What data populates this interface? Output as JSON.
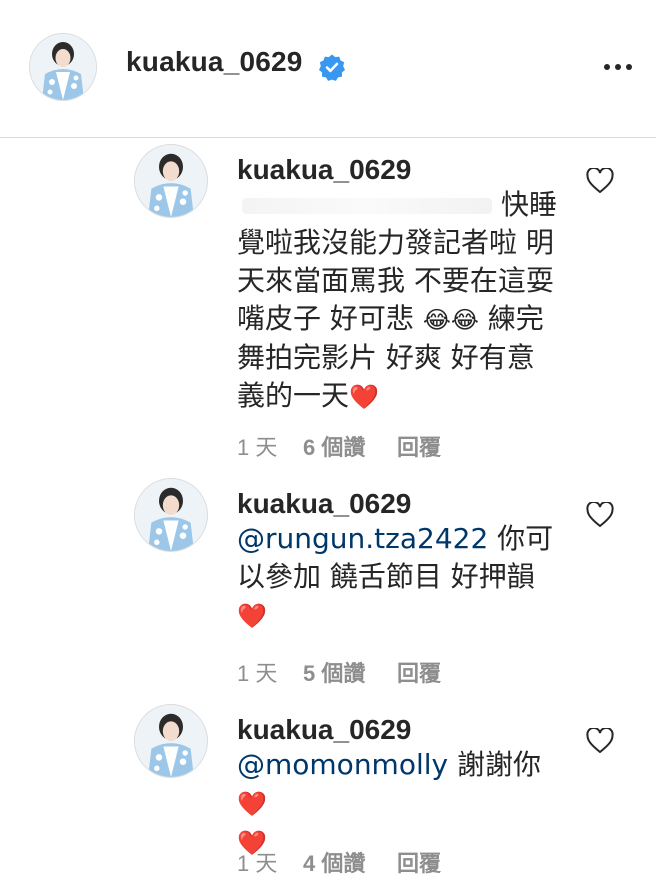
{
  "header": {
    "username": "kuakua_0629",
    "verified_icon": "verified-badge-icon",
    "more_icon": "more-options-icon"
  },
  "comments": [
    {
      "username": "kuakua_0629",
      "line1": "快睡",
      "lines": [
        "覺啦我沒能力發記者啦 明",
        "天來當面罵我 不要在這耍"
      ],
      "line4_text": "嘴皮子 好可悲 ",
      "line4_emoji": "😂😂",
      "line4_tail": " 練完",
      "line5": "舞拍完影片 好爽 好有意",
      "line6_text": "義的一天",
      "line6_emoji": "❤️",
      "time": "1 天",
      "likes": "6 個讚",
      "reply": "回覆"
    },
    {
      "username": "kuakua_0629",
      "mention": "@rungun.tza2422",
      "text1": " 你可",
      "text2": "以參加 饒舌節目 好押韻",
      "emoji": "❤️",
      "time": "1 天",
      "likes": "5 個讚",
      "reply": "回覆"
    },
    {
      "username": "kuakua_0629",
      "mention": "@momonmolly",
      "text1": " 謝謝你",
      "emoji1": "❤️",
      "emoji2": "❤️",
      "time": "1 天",
      "likes": "4 個讚",
      "reply": "回覆"
    }
  ],
  "colors": {
    "text": "#262626",
    "secondary": "#8e8e8e",
    "mention": "#00376b",
    "verified": "#3897f0",
    "divider": "#dbdbdb"
  }
}
